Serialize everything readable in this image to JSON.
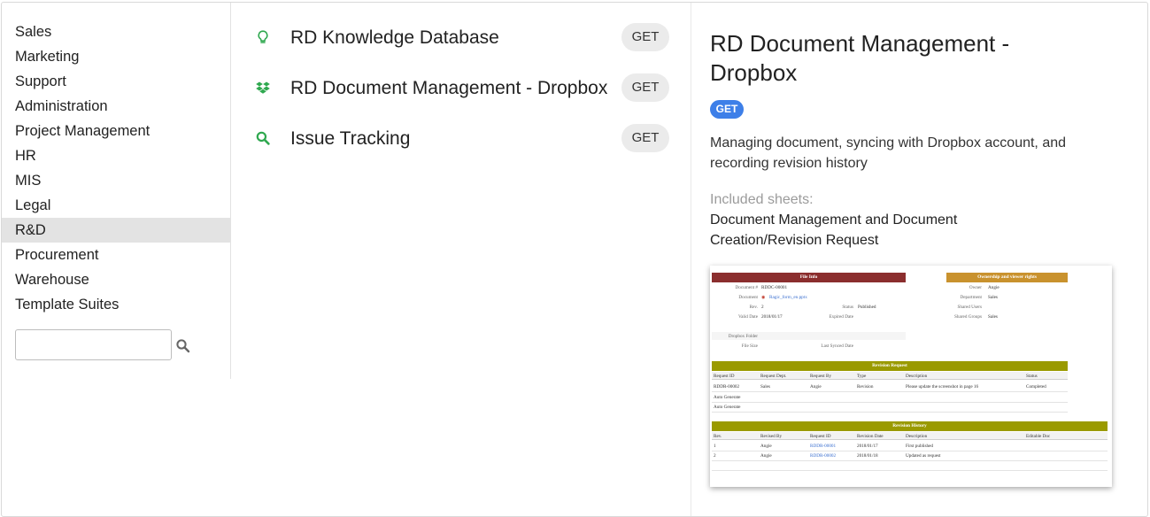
{
  "categories": {
    "items": [
      "Sales",
      "Marketing",
      "Support",
      "Administration",
      "Project Management",
      "HR",
      "MIS",
      "Legal",
      "R&D",
      "Procurement",
      "Warehouse",
      "Template Suites"
    ],
    "selected": "R&D",
    "search_value": "",
    "search_icon": "search-icon"
  },
  "templates": [
    {
      "title": "RD Knowledge Database",
      "icon": "lightbulb-icon",
      "icon_color": "#2fa84f",
      "action": "GET"
    },
    {
      "title": "RD Document Management - Dropbox",
      "icon": "dropbox-icon",
      "icon_color": "#2fa84f",
      "action": "GET"
    },
    {
      "title": "Issue Tracking",
      "icon": "search-icon",
      "icon_color": "#2fa84f",
      "action": "GET"
    }
  ],
  "detail": {
    "title": "RD Document Management - Dropbox",
    "get_label": "GET",
    "get_color": "#3d7fe8",
    "description": "Managing document, syncing with Dropbox account, and recording revision history",
    "included_label": "Included sheets:",
    "included_sheets": "Document Management and Document Creation/Revision Request"
  },
  "preview": {
    "file_info": {
      "header": "File Info",
      "color": "#8b2e2e",
      "doc_no_label": "Document #",
      "doc_no": "RDDC-00001",
      "document_label": "Document",
      "document": "Ragic_form_en.pptx",
      "rev_label": "Rev.",
      "rev": "2",
      "status_label": "Status",
      "status": "Published",
      "valid_label": "Valid Date",
      "valid": "2018/01/17",
      "expired_label": "Expired Date",
      "folder_label": "Dropbox Folder",
      "size_label": "File Size",
      "synced_label": "Last Synced Date"
    },
    "ownership": {
      "header": "Ownership and viewer rights",
      "color": "#c9922e",
      "owner_label": "Owner",
      "owner": "Angie",
      "dept_label": "Department",
      "dept": "Sales",
      "users_label": "Shared Users",
      "groups_label": "Shared Groups",
      "groups": "Sales"
    },
    "revision_request": {
      "header": "Revision Request",
      "color": "#9a9a00",
      "columns": [
        "Request ID",
        "Request Dept.",
        "Request By",
        "Type",
        "Description",
        "Status"
      ],
      "rows": [
        [
          "RDDR-00002",
          "Sales",
          "Angie",
          "Revision",
          "Please update the screenshot in page 16",
          "Completed"
        ],
        [
          "Auto Generate",
          "",
          "",
          "",
          "",
          ""
        ],
        [
          "Auto Generate",
          "",
          "",
          "",
          "",
          ""
        ]
      ]
    },
    "revision_history": {
      "header": "Revision History",
      "color": "#9a9a00",
      "columns": [
        "Rev.",
        "Revised By",
        "Request ID",
        "Revision Date",
        "Description",
        "Editable Doc"
      ],
      "rows": [
        [
          "1",
          "Angie",
          "RDDR-00001",
          "2018/01/17",
          "First published",
          ""
        ],
        [
          "2",
          "Angie",
          "RDDR-00002",
          "2018/01/18",
          "Updated as request",
          ""
        ]
      ]
    }
  }
}
